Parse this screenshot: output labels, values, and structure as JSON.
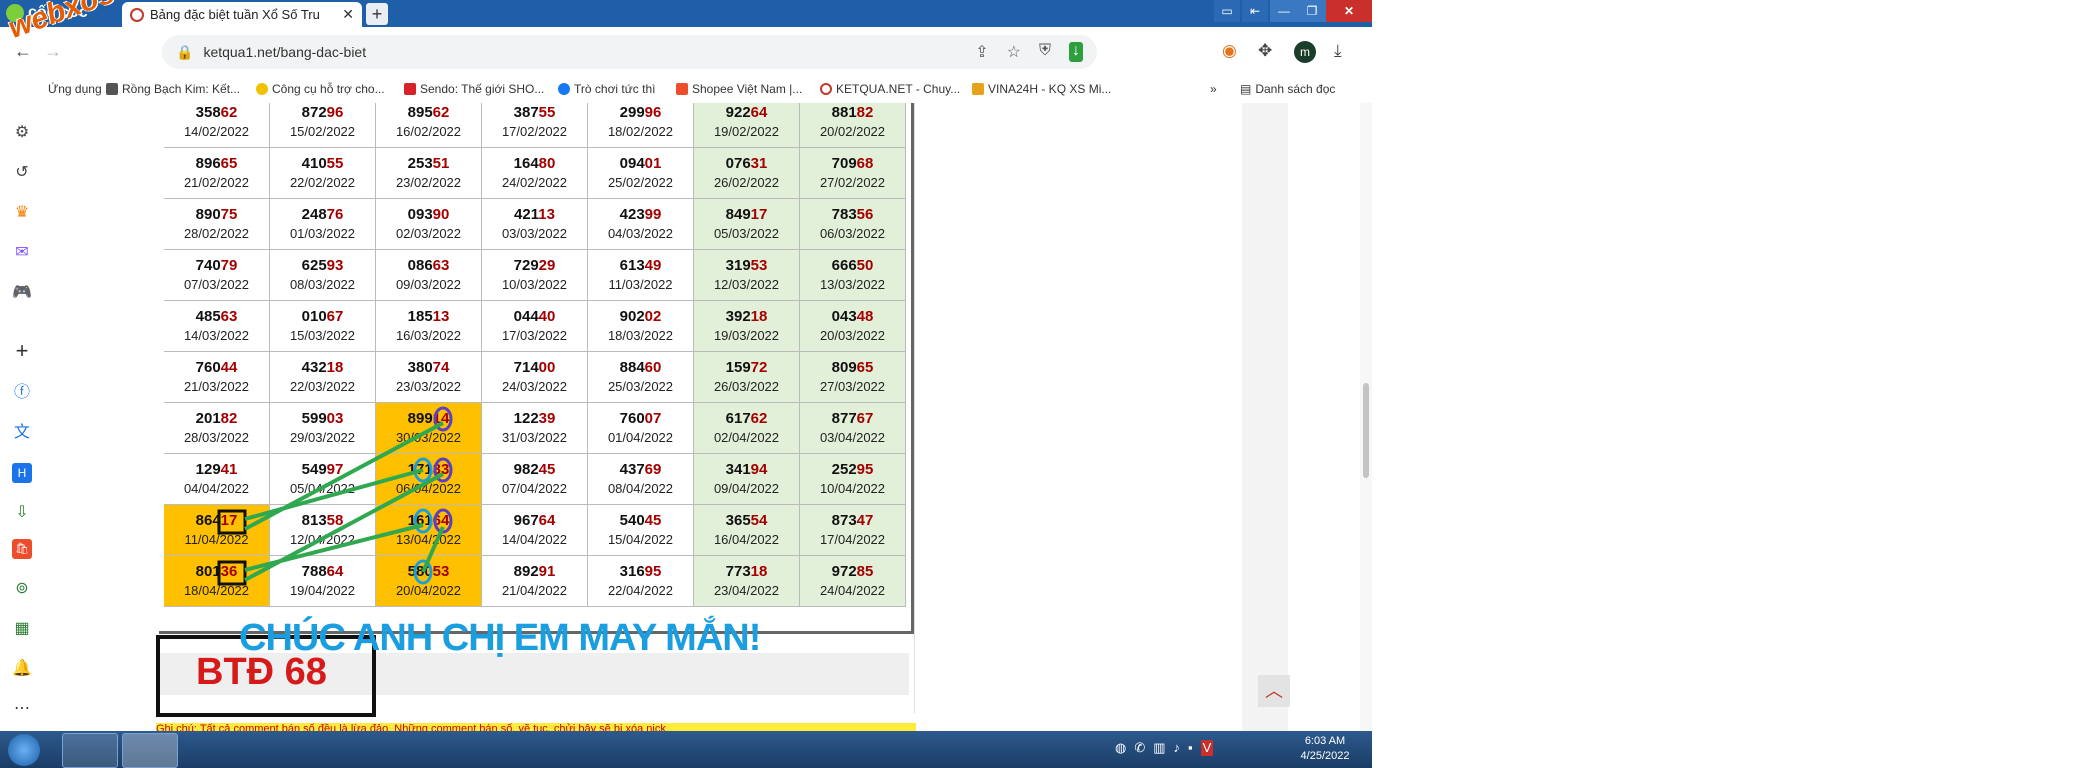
{
  "browser": {
    "brand": "cốc cốc",
    "tab_title": "Bảng đặc biệt tuần Xổ Số Tru",
    "new_tab": "+",
    "url": "ketqua1.net/bang-dac-biet",
    "bookmarks": [
      "Ứng dụng",
      "Rồng Bạch Kim: Kết...",
      "Công cụ hỗ trợ cho...",
      "Sendo: Thế giới SHO...",
      "Trò chơi tức thì",
      "Shopee Việt Nam |...",
      "KETQUA.NET - Chuy...",
      "VINA24H - KQ XS Mi..."
    ],
    "bookmark_overflow": "»",
    "reading_list": "Danh sách đọc",
    "avatar_letter": "m",
    "colors": {
      "titlebar": "#1f5fa8",
      "green_cell": "#e2f0d9",
      "highlight": "#ffc000",
      "tail_digits": "#a40000",
      "banner": "#1a9ee0",
      "btd": "#d61a1a"
    }
  },
  "watermark": "webxoso.net",
  "table": {
    "rows": [
      [
        {
          "n": "358",
          "t": "62",
          "d": "14/02/2022"
        },
        {
          "n": "872",
          "t": "96",
          "d": "15/02/2022"
        },
        {
          "n": "895",
          "t": "62",
          "d": "16/02/2022"
        },
        {
          "n": "387",
          "t": "55",
          "d": "17/02/2022"
        },
        {
          "n": "299",
          "t": "96",
          "d": "18/02/2022"
        },
        {
          "n": "922",
          "t": "64",
          "d": "19/02/2022"
        },
        {
          "n": "881",
          "t": "82",
          "d": "20/02/2022"
        }
      ],
      [
        {
          "n": "896",
          "t": "65",
          "d": "21/02/2022"
        },
        {
          "n": "410",
          "t": "55",
          "d": "22/02/2022"
        },
        {
          "n": "253",
          "t": "51",
          "d": "23/02/2022"
        },
        {
          "n": "164",
          "t": "80",
          "d": "24/02/2022"
        },
        {
          "n": "094",
          "t": "01",
          "d": "25/02/2022"
        },
        {
          "n": "076",
          "t": "31",
          "d": "26/02/2022"
        },
        {
          "n": "709",
          "t": "68",
          "d": "27/02/2022"
        }
      ],
      [
        {
          "n": "890",
          "t": "75",
          "d": "28/02/2022"
        },
        {
          "n": "248",
          "t": "76",
          "d": "01/03/2022"
        },
        {
          "n": "093",
          "t": "90",
          "d": "02/03/2022"
        },
        {
          "n": "421",
          "t": "13",
          "d": "03/03/2022"
        },
        {
          "n": "423",
          "t": "99",
          "d": "04/03/2022"
        },
        {
          "n": "849",
          "t": "17",
          "d": "05/03/2022"
        },
        {
          "n": "783",
          "t": "56",
          "d": "06/03/2022"
        }
      ],
      [
        {
          "n": "740",
          "t": "79",
          "d": "07/03/2022"
        },
        {
          "n": "625",
          "t": "93",
          "d": "08/03/2022"
        },
        {
          "n": "086",
          "t": "63",
          "d": "09/03/2022"
        },
        {
          "n": "729",
          "t": "29",
          "d": "10/03/2022"
        },
        {
          "n": "613",
          "t": "49",
          "d": "11/03/2022"
        },
        {
          "n": "319",
          "t": "53",
          "d": "12/03/2022"
        },
        {
          "n": "666",
          "t": "50",
          "d": "13/03/2022"
        }
      ],
      [
        {
          "n": "485",
          "t": "63",
          "d": "14/03/2022"
        },
        {
          "n": "010",
          "t": "67",
          "d": "15/03/2022"
        },
        {
          "n": "185",
          "t": "13",
          "d": "16/03/2022"
        },
        {
          "n": "044",
          "t": "40",
          "d": "17/03/2022"
        },
        {
          "n": "902",
          "t": "02",
          "d": "18/03/2022"
        },
        {
          "n": "392",
          "t": "18",
          "d": "19/03/2022"
        },
        {
          "n": "043",
          "t": "48",
          "d": "20/03/2022"
        }
      ],
      [
        {
          "n": "760",
          "t": "44",
          "d": "21/03/2022"
        },
        {
          "n": "432",
          "t": "18",
          "d": "22/03/2022"
        },
        {
          "n": "380",
          "t": "74",
          "d": "23/03/2022"
        },
        {
          "n": "714",
          "t": "00",
          "d": "24/03/2022"
        },
        {
          "n": "884",
          "t": "60",
          "d": "25/03/2022"
        },
        {
          "n": "159",
          "t": "72",
          "d": "26/03/2022"
        },
        {
          "n": "809",
          "t": "65",
          "d": "27/03/2022"
        }
      ],
      [
        {
          "n": "201",
          "t": "82",
          "d": "28/03/2022"
        },
        {
          "n": "599",
          "t": "03",
          "d": "29/03/2022"
        },
        {
          "n": "899",
          "t": "14",
          "d": "30/03/2022"
        },
        {
          "n": "122",
          "t": "39",
          "d": "31/03/2022"
        },
        {
          "n": "760",
          "t": "07",
          "d": "01/04/2022"
        },
        {
          "n": "617",
          "t": "62",
          "d": "02/04/2022"
        },
        {
          "n": "877",
          "t": "67",
          "d": "03/04/2022"
        }
      ],
      [
        {
          "n": "129",
          "t": "41",
          "d": "04/04/2022"
        },
        {
          "n": "549",
          "t": "97",
          "d": "05/04/2022"
        },
        {
          "n": "171",
          "t": "33",
          "d": "06/04/2022"
        },
        {
          "n": "982",
          "t": "45",
          "d": "07/04/2022"
        },
        {
          "n": "437",
          "t": "69",
          "d": "08/04/2022"
        },
        {
          "n": "341",
          "t": "94",
          "d": "09/04/2022"
        },
        {
          "n": "252",
          "t": "95",
          "d": "10/04/2022"
        }
      ],
      [
        {
          "n": "864",
          "t": "17",
          "d": "11/04/2022"
        },
        {
          "n": "813",
          "t": "58",
          "d": "12/04/2022"
        },
        {
          "n": "161",
          "t": "64",
          "d": "13/04/2022"
        },
        {
          "n": "967",
          "t": "64",
          "d": "14/04/2022"
        },
        {
          "n": "540",
          "t": "45",
          "d": "15/04/2022"
        },
        {
          "n": "365",
          "t": "54",
          "d": "16/04/2022"
        },
        {
          "n": "873",
          "t": "47",
          "d": "17/04/2022"
        }
      ],
      [
        {
          "n": "801",
          "t": "36",
          "d": "18/04/2022"
        },
        {
          "n": "788",
          "t": "64",
          "d": "19/04/2022"
        },
        {
          "n": "580",
          "t": "53",
          "d": "20/04/2022"
        },
        {
          "n": "892",
          "t": "91",
          "d": "21/04/2022"
        },
        {
          "n": "316",
          "t": "95",
          "d": "22/04/2022"
        },
        {
          "n": "773",
          "t": "18",
          "d": "23/04/2022"
        },
        {
          "n": "972",
          "t": "85",
          "d": "24/04/2022"
        }
      ]
    ],
    "highlighted": [
      [
        6,
        2
      ],
      [
        7,
        2
      ],
      [
        8,
        0
      ],
      [
        8,
        2
      ],
      [
        9,
        0
      ],
      [
        9,
        2
      ]
    ]
  },
  "banner_text": "CHÚC ANH CHỊ EM MAY MẮN!",
  "btd_text": "BTĐ 68",
  "note_text": "Ghi chú: Tất cả comment bán số đều là lừa đảo. Những comment bán số, vẽ tục, chửi bậy sẽ bị xóa nick.",
  "taskbar": {
    "time": "6:03 AM",
    "date": "4/25/2022"
  }
}
